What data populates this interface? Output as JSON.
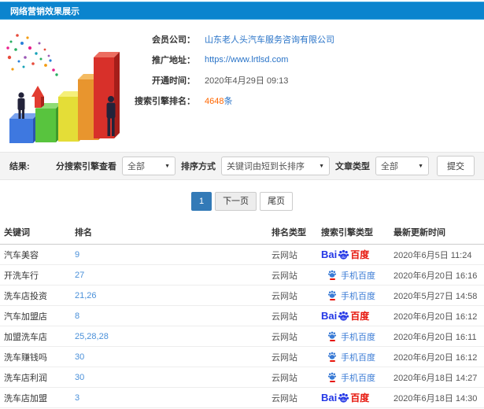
{
  "header": {
    "title": "网络营销效果展示"
  },
  "info": {
    "company_label": "会员公司：",
    "company_value": "山东老人头汽车服务咨询有限公司",
    "url_label": "推广地址：",
    "url_value": "https://www.lrtlsd.com",
    "open_time_label": "开通时间：",
    "open_time_value": "2020年4月29日 09:13",
    "rank_label": "搜索引擎排名：",
    "rank_count": "4648",
    "rank_unit": "条"
  },
  "filters": {
    "result_label": "结果:",
    "engine_filter_label": "分搜索引擎查看",
    "engine_filter_value": "全部",
    "sort_label": "排序方式",
    "sort_value": "关键词由短到长排序",
    "article_label": "文章类型",
    "article_value": "全部",
    "submit_label": "提交",
    "dropdown_arrow": "▼"
  },
  "pagination": {
    "current": "1",
    "next": "下一页",
    "last": "尾页"
  },
  "table": {
    "columns": [
      "关键词",
      "排名",
      "排名类型",
      "搜索引擎类型",
      "最新更新时间"
    ],
    "rows": [
      {
        "keyword": "汽车美容",
        "rank": "9",
        "rank_type": "云网站",
        "engine": "baidu",
        "updated": "2020年6月5日 11:24"
      },
      {
        "keyword": "开洗车行",
        "rank": "27",
        "rank_type": "云网站",
        "engine": "mobile_baidu",
        "updated": "2020年6月20日 16:16"
      },
      {
        "keyword": "洗车店投资",
        "rank": "21,26",
        "rank_type": "云网站",
        "engine": "mobile_baidu",
        "updated": "2020年5月27日 14:58"
      },
      {
        "keyword": "汽车加盟店",
        "rank": "8",
        "rank_type": "云网站",
        "engine": "baidu",
        "updated": "2020年6月20日 16:12"
      },
      {
        "keyword": "加盟洗车店",
        "rank": "25,28,28",
        "rank_type": "云网站",
        "engine": "mobile_baidu",
        "updated": "2020年6月20日 16:11"
      },
      {
        "keyword": "洗车赚钱吗",
        "rank": "30",
        "rank_type": "云网站",
        "engine": "mobile_baidu",
        "updated": "2020年6月20日 16:12"
      },
      {
        "keyword": "洗车店利润",
        "rank": "30",
        "rank_type": "云网站",
        "engine": "mobile_baidu",
        "updated": "2020年6月18日 14:27"
      },
      {
        "keyword": "洗车店加盟",
        "rank": "3",
        "rank_type": "云网站",
        "engine": "baidu",
        "updated": "2020年6月18日 14:30"
      }
    ]
  },
  "engines": {
    "baidu": {
      "text_bai": "Bai",
      "text_cn": "百度",
      "color_blue": "#2438e6",
      "color_red": "#e6140a"
    },
    "mobile_baidu": {
      "label": "手机百度",
      "color": "#3a7bd5"
    }
  },
  "colors": {
    "header_bg": "#0b84ce",
    "link_blue": "#2a74c8",
    "rank_blue": "#4a90d9",
    "accent_orange": "#ff6600",
    "active_page_blue": "#337ab7",
    "filter_bar_bg": "#f4f4f4"
  }
}
